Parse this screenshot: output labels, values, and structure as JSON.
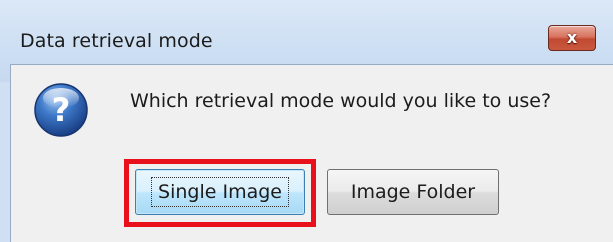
{
  "window": {
    "title": "Data retrieval mode",
    "close_label": "x"
  },
  "dialog": {
    "icon": "question-icon",
    "message": "Which retrieval mode would you like to use?",
    "buttons": {
      "single_image": "Single Image",
      "image_folder": "Image Folder"
    }
  },
  "colors": {
    "highlight": "#e8101a",
    "title_bar": "#cddff3",
    "close_button": "#c14a31",
    "icon_blue": "#2a5fa8"
  }
}
